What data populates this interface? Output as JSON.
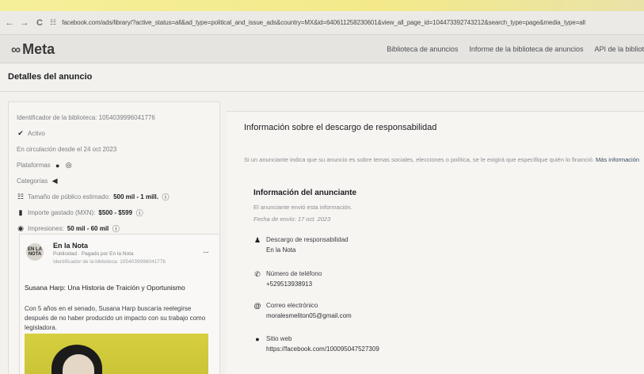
{
  "browser": {
    "back": "←",
    "forward": "→",
    "reload": "C",
    "url": "facebook.com/ads/library/?active_status=all&ad_type=political_and_issue_ads&country=MX&id=640611258230601&view_all_page_id=104473392743212&search_type=page&media_type=all"
  },
  "header": {
    "logo": "Meta",
    "nav": [
      "Biblioteca de anuncios",
      "Informe de la biblioteca de anuncios",
      "API de la bibliot"
    ]
  },
  "page_title": "Detalles del anuncio",
  "details": {
    "library_id": "Identificador de la biblioteca: 1054039996041776",
    "status": "Activo",
    "running_since": "En circulación desde el 24 oct 2023",
    "platforms_label": "Plataformas",
    "categories_label": "Categorías",
    "audience_label": "Tamaño de público estimado:",
    "audience_value": "500 mil - 1 mill.",
    "spend_label": "Importe gastado (MXN):",
    "spend_value": "$500 - $599",
    "impressions_label": "Impresiones:",
    "impressions_value": "50 mil - 60 mil"
  },
  "ad": {
    "avatar_text": "EN LA NOTA",
    "page_name": "En la Nota",
    "sponsored": "Publicidad · Pagado por En la Nota",
    "library_id": "Identificador de la biblioteca: 1054039996041776",
    "more": "···",
    "headline": "Susana Harp: Una Historia de Traición y Oportunismo",
    "body": "Con 5 años en el senado, Susana Harp buscaría reelegirse después de no haber producido un impacto con su trabajo como legisladora."
  },
  "disclaimer": {
    "title": "Información sobre el descargo de responsabilidad",
    "description": "Si un anunciante indica que su anuncio es sobre temas sociales, elecciones o política, se le exigirá que especifique quién lo financió.",
    "more_link": "Más información"
  },
  "advertiser": {
    "title": "Información del anunciante",
    "sent_by": "El anunciante envió esta información.",
    "sent_date": "Fecha de envío: 17 oct. 2023",
    "disclaimer_label": "Descargo de responsabilidad",
    "disclaimer_value": "En la Nota",
    "phone_label": "Número de teléfono",
    "phone_value": "+529513938913",
    "email_label": "Correo electrónico",
    "email_value": "moralesmeliton05@gmail.com",
    "website_label": "Sitio web",
    "website_value": "https://facebook.com/100095047527309"
  },
  "colors": {
    "accent_link": "#3b4a62",
    "ad_image_bg": "#d6cf3e"
  }
}
